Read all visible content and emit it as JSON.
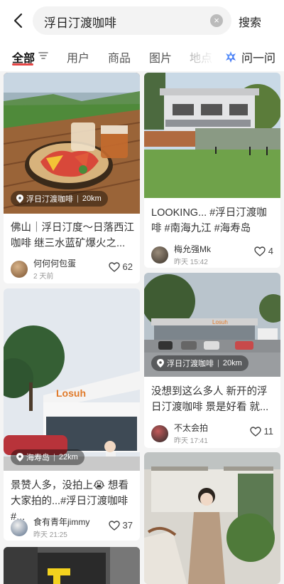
{
  "search": {
    "query": "浮日汀渡咖啡",
    "button": "搜索"
  },
  "tabs": [
    "全部",
    "用户",
    "商品",
    "图片",
    "地点"
  ],
  "ask": "问一问",
  "colors": {
    "accent": "#e64545"
  },
  "posts": [
    {
      "location": "浮日汀渡咖啡",
      "distance": "20km",
      "title": "佛山｜浮日汀度～日落西江咖啡 继三水蓝矿爆火之...",
      "author": "何何何包蛋",
      "date": "2 天前",
      "likes": "62"
    },
    {
      "location": "",
      "distance": "",
      "title": "LOOKING... #浮日汀渡咖啡 #南海九江 #海寿岛",
      "author": "梅允强Mk",
      "date": "昨天 15:42",
      "likes": "4"
    },
    {
      "location": "浮日汀渡咖啡",
      "distance": "20km",
      "title": "没想到这么多人 新开的浮日汀渡咖啡 景是好看 就...",
      "author": "不太会拍",
      "date": "昨天 17:41",
      "likes": "11"
    },
    {
      "location": "海寿岛",
      "distance": "22km",
      "title": "景赞人多，没拍上😭 想看大家拍的...#浮日汀渡咖啡 #...",
      "author": "食有青年jimmy",
      "date": "昨天 21:25",
      "likes": "37"
    }
  ]
}
